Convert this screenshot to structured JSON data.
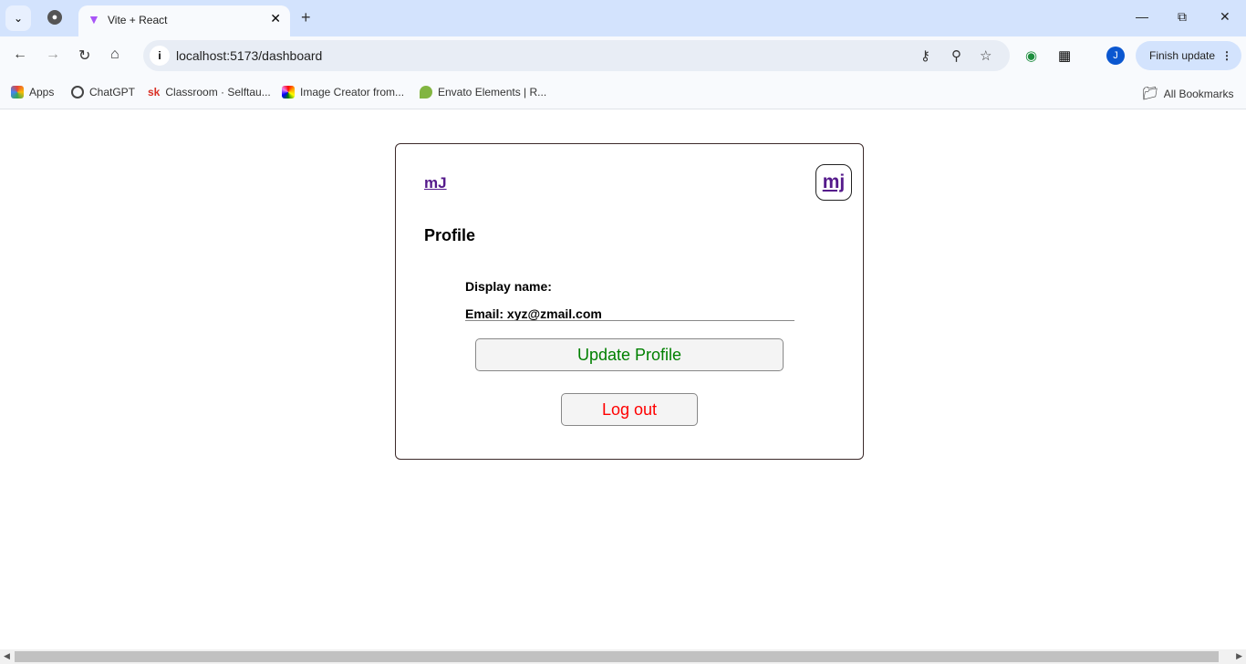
{
  "browser": {
    "tab_title": "Vite + React",
    "url": "localhost:5173/dashboard",
    "finish_update": "Finish update",
    "profile_initial": "J",
    "bookmarks": [
      {
        "label": "Apps",
        "color": "#ea4335"
      },
      {
        "label": "ChatGPT",
        "color": "#444444"
      },
      {
        "label": "Classroom · Selftau...",
        "color": "#d93025"
      },
      {
        "label": "Image Creator from...",
        "color": "#f4b400"
      },
      {
        "label": "Envato Elements | R...",
        "color": "#82b541"
      }
    ],
    "all_bookmarks": "All Bookmarks"
  },
  "page": {
    "logo": "mJ",
    "avatar": "mj",
    "title": "Profile",
    "display_name_label": "Display name:",
    "email_label": "Email: xyz@zmail.com",
    "update_button": "Update Profile",
    "logout_button": "Log out",
    "colors": {
      "update": "#008000",
      "logout": "#ff0000",
      "link": "#551a8b"
    }
  }
}
